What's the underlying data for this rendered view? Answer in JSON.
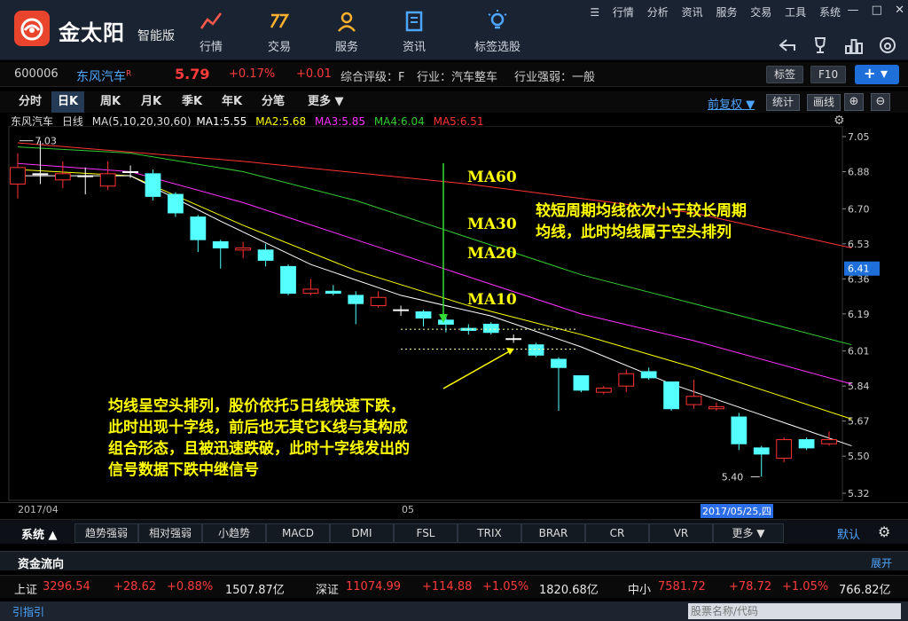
{
  "app": {
    "brand": "金太阳",
    "edition": "智能版",
    "nav": [
      {
        "label": "行情",
        "icon": "trend-icon"
      },
      {
        "label": "交易",
        "icon": "trade-icon"
      },
      {
        "label": "服务",
        "icon": "user-icon"
      },
      {
        "label": "资讯",
        "icon": "news-icon"
      },
      {
        "label": "标签选股",
        "icon": "bulb-icon"
      }
    ],
    "top_menu": [
      "行情",
      "分析",
      "资讯",
      "服务",
      "交易",
      "工具",
      "系统"
    ]
  },
  "stock": {
    "code": "600006",
    "name": "东风汽车",
    "name_mark": "R",
    "price": "5.79",
    "change_pct": "+0.17%",
    "change": "+0.01",
    "rating": "综合评级：F",
    "industry": "行业：汽车整车",
    "strength": "行业强弱：一般",
    "btn_tag": "标签",
    "btn_f10": "F10",
    "btn_add": "+ ▾"
  },
  "periods": [
    "分时",
    "日K",
    "周K",
    "月K",
    "季K",
    "年K",
    "分笔",
    "更多 ▼"
  ],
  "toolbar": {
    "adjust": "前复权 ▼",
    "stats": "统计",
    "draw": "画线",
    "zoom_in": "⊕",
    "zoom_out": "⊖"
  },
  "ma_legend": {
    "name": "东风汽车",
    "period": "日线",
    "ma_spec": "MA(5,10,20,30,60)",
    "items": [
      {
        "text": "MA1:5.55",
        "color": "#ffffff"
      },
      {
        "text": "MA2:5.68",
        "color": "#ffff00"
      },
      {
        "text": "MA3:5.85",
        "color": "#ff33ff"
      },
      {
        "text": "MA4:6.04",
        "color": "#33cc33"
      },
      {
        "text": "MA5:6.51",
        "color": "#ff3333"
      }
    ]
  },
  "chart_data": {
    "type": "candlestick",
    "yticks": [
      "7.05",
      "6.88",
      "6.70",
      "6.53",
      "6.36",
      "6.19",
      "6.01",
      "5.84",
      "5.67",
      "5.50",
      "5.32"
    ],
    "ylim": [
      5.32,
      7.05
    ],
    "current_price_tag": "6.41",
    "high_label": "7.03",
    "low_label": "5.40",
    "candles": [
      {
        "o": 6.82,
        "c": 6.9,
        "h": 6.97,
        "l": 6.75
      },
      {
        "o": 6.87,
        "c": 6.87,
        "h": 7.03,
        "l": 6.82
      },
      {
        "o": 6.84,
        "c": 6.87,
        "h": 6.93,
        "l": 6.8
      },
      {
        "o": 6.86,
        "c": 6.86,
        "h": 6.9,
        "l": 6.77
      },
      {
        "o": 6.81,
        "c": 6.87,
        "h": 6.93,
        "l": 6.79
      },
      {
        "o": 6.88,
        "c": 6.88,
        "h": 6.91,
        "l": 6.85
      },
      {
        "o": 6.87,
        "c": 6.76,
        "h": 6.89,
        "l": 6.74
      },
      {
        "o": 6.77,
        "c": 6.68,
        "h": 6.78,
        "l": 6.66
      },
      {
        "o": 6.66,
        "c": 6.55,
        "h": 6.67,
        "l": 6.49
      },
      {
        "o": 6.54,
        "c": 6.51,
        "h": 6.55,
        "l": 6.41
      },
      {
        "o": 6.5,
        "c": 6.51,
        "h": 6.54,
        "l": 6.46
      },
      {
        "o": 6.5,
        "c": 6.45,
        "h": 6.53,
        "l": 6.42
      },
      {
        "o": 6.42,
        "c": 6.29,
        "h": 6.43,
        "l": 6.28
      },
      {
        "o": 6.29,
        "c": 6.31,
        "h": 6.36,
        "l": 6.28
      },
      {
        "o": 6.3,
        "c": 6.29,
        "h": 6.33,
        "l": 6.28
      },
      {
        "o": 6.28,
        "c": 6.24,
        "h": 6.3,
        "l": 6.14
      },
      {
        "o": 6.23,
        "c": 6.27,
        "h": 6.3,
        "l": 6.22
      },
      {
        "o": 6.21,
        "c": 6.21,
        "h": 6.23,
        "l": 6.18
      },
      {
        "o": 6.2,
        "c": 6.17,
        "h": 6.21,
        "l": 6.13
      },
      {
        "o": 6.16,
        "c": 6.14,
        "h": 6.18,
        "l": 6.1
      },
      {
        "o": 6.12,
        "c": 6.11,
        "h": 6.14,
        "l": 6.09
      },
      {
        "o": 6.14,
        "c": 6.1,
        "h": 6.15,
        "l": 6.09
      },
      {
        "o": 6.07,
        "c": 6.07,
        "h": 6.09,
        "l": 6.05
      },
      {
        "o": 6.04,
        "c": 5.99,
        "h": 6.05,
        "l": 5.98
      },
      {
        "o": 5.97,
        "c": 5.93,
        "h": 5.98,
        "l": 5.72
      },
      {
        "o": 5.89,
        "c": 5.82,
        "h": 5.89,
        "l": 5.81
      },
      {
        "o": 5.81,
        "c": 5.83,
        "h": 5.84,
        "l": 5.8
      },
      {
        "o": 5.84,
        "c": 5.9,
        "h": 5.92,
        "l": 5.81
      },
      {
        "o": 5.91,
        "c": 5.88,
        "h": 5.93,
        "l": 5.87
      },
      {
        "o": 5.86,
        "c": 5.73,
        "h": 5.86,
        "l": 5.72
      },
      {
        "o": 5.75,
        "c": 5.79,
        "h": 5.87,
        "l": 5.73
      },
      {
        "o": 5.73,
        "c": 5.74,
        "h": 5.76,
        "l": 5.72
      },
      {
        "o": 5.69,
        "c": 5.56,
        "h": 5.71,
        "l": 5.53
      },
      {
        "o": 5.54,
        "c": 5.51,
        "h": 5.55,
        "l": 5.4
      },
      {
        "o": 5.49,
        "c": 5.58,
        "h": 5.59,
        "l": 5.47
      },
      {
        "o": 5.58,
        "c": 5.54,
        "h": 5.59,
        "l": 5.53
      },
      {
        "o": 5.56,
        "c": 5.58,
        "h": 5.62,
        "l": 5.55
      }
    ],
    "ma_series": [
      {
        "name": "MA60",
        "color": "#ff3333",
        "points": [
          [
            0,
            7.02
          ],
          [
            10,
            6.93
          ],
          [
            20,
            6.82
          ],
          [
            30,
            6.68
          ],
          [
            37,
            6.51
          ]
        ]
      },
      {
        "name": "MA30",
        "color": "#33cc33",
        "points": [
          [
            0,
            7.0
          ],
          [
            5,
            6.97
          ],
          [
            10,
            6.88
          ],
          [
            15,
            6.74
          ],
          [
            20,
            6.56
          ],
          [
            25,
            6.38
          ],
          [
            30,
            6.24
          ],
          [
            37,
            6.04
          ]
        ]
      },
      {
        "name": "MA20",
        "color": "#ff33ff",
        "points": [
          [
            0,
            6.92
          ],
          [
            5,
            6.88
          ],
          [
            10,
            6.73
          ],
          [
            15,
            6.55
          ],
          [
            20,
            6.37
          ],
          [
            25,
            6.19
          ],
          [
            30,
            6.06
          ],
          [
            37,
            5.85
          ]
        ]
      },
      {
        "name": "MA10",
        "color": "#ffff00",
        "points": [
          [
            0,
            6.89
          ],
          [
            5,
            6.86
          ],
          [
            10,
            6.62
          ],
          [
            15,
            6.4
          ],
          [
            20,
            6.23
          ],
          [
            25,
            6.09
          ],
          [
            30,
            5.93
          ],
          [
            37,
            5.68
          ]
        ]
      },
      {
        "name": "MA5",
        "color": "#ffffff",
        "points": [
          [
            0,
            6.86
          ],
          [
            5,
            6.86
          ],
          [
            9,
            6.64
          ],
          [
            13,
            6.43
          ],
          [
            17,
            6.28
          ],
          [
            21,
            6.18
          ],
          [
            25,
            6.03
          ],
          [
            29,
            5.85
          ],
          [
            33,
            5.7
          ],
          [
            37,
            5.55
          ]
        ]
      }
    ],
    "annotations": {
      "ma60": "MA60",
      "ma30": "MA30",
      "ma20": "MA20",
      "ma10": "MA10",
      "top_right": [
        "较短周期均线依次小于较长周期",
        "均线，此时均线属于空头排列"
      ],
      "bottom_left": [
        "均线呈空头排列，股价依托5日线快速下跌，",
        "此时出现十字线，前后也无其它K线与其构成",
        "组合形态，且被迅速跌破，此时十字线发出的",
        "信号数据下跌中继信号"
      ]
    },
    "x_labels": [
      "2017/04",
      "05"
    ],
    "cursor_date": "2017/05/25,四"
  },
  "indicators": {
    "system": "系统",
    "tabs": [
      "趋势强弱",
      "相对强弱",
      "小趋势",
      "MACD",
      "DMI",
      "FSL",
      "TRIX",
      "BRAR",
      "CR",
      "VR",
      "更多"
    ],
    "default": "默认"
  },
  "capital": {
    "title": "资金流向",
    "expand": "展开"
  },
  "market": [
    {
      "name": "上证",
      "value": "3296.54",
      "chg": "+28.62",
      "pct": "+0.88%",
      "amount": "1507.87亿"
    },
    {
      "name": "深证",
      "value": "11074.99",
      "chg": "+114.88",
      "pct": "+1.05%",
      "amount": "1820.68亿"
    },
    {
      "name": "中小",
      "value": "7581.72",
      "chg": "+78.72",
      "pct": "+1.05%",
      "amount": "766.82亿"
    }
  ],
  "status": {
    "left": "引指引",
    "search_placeholder": "股票名称/代码"
  }
}
